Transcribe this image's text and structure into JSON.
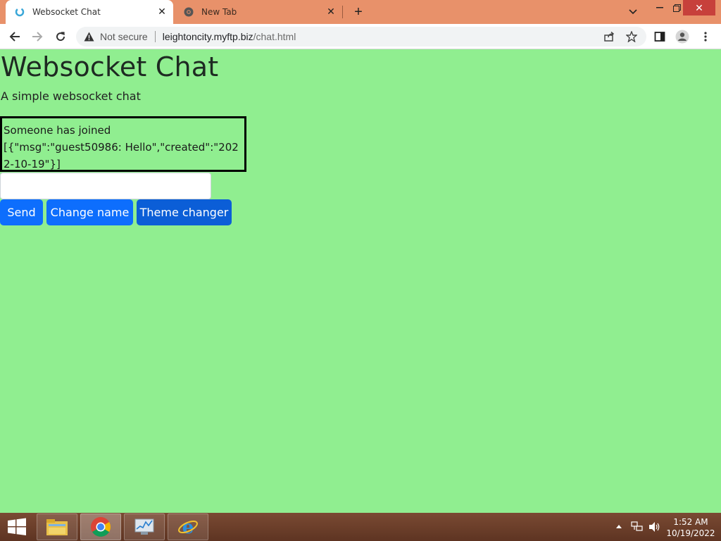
{
  "browser": {
    "tabs": [
      {
        "title": "Websocket Chat",
        "favicon": "websocket-favicon-icon",
        "active": true
      },
      {
        "title": "New Tab",
        "favicon": "chrome-icon",
        "active": false
      }
    ],
    "address": {
      "security_label": "Not secure",
      "host": "leightoncity.myftp.biz",
      "path": "/chat.html"
    }
  },
  "page": {
    "title": "Websocket Chat",
    "subtitle": "A simple websocket chat",
    "messages": [
      "Someone has joined",
      "[{\"msg\":\"guest50986: Hello\",\"created\":\"2022-10-19\"}]"
    ],
    "input": {
      "value": "",
      "placeholder": ""
    },
    "buttons": {
      "send": "Send",
      "change_name": "Change name",
      "theme_changer": "Theme changer"
    },
    "colors": {
      "background": "#90ee90",
      "button": "#0d6efd"
    }
  },
  "taskbar": {
    "apps": [
      "file-explorer-icon",
      "chrome-icon",
      "task-manager-icon",
      "internet-explorer-icon"
    ],
    "clock": {
      "time": "1:52 AM",
      "date": "10/19/2022"
    }
  }
}
